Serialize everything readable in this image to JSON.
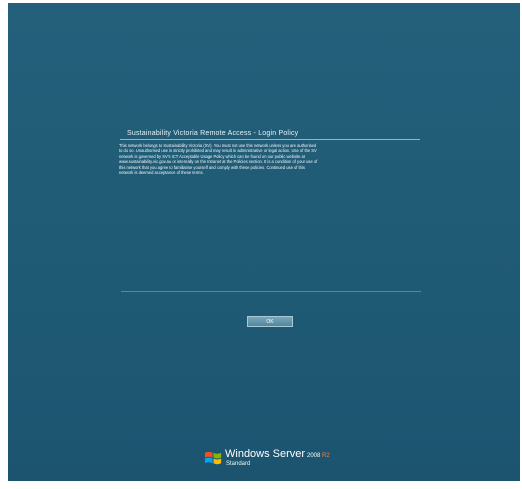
{
  "dialog": {
    "title": "Sustainability Victoria Remote Access - Login Policy",
    "policy_text": "This network belongs to Sustainability Victoria (SV). You must not use this network unless you are authorised\nto do so. Unauthorised use is strictly prohibited and may result in administrative or legal action. Use of the SV\nnetwork is governed by SV's ICT Acceptable Usage Policy which can be found on our public website at\nwww.sustainability.vic.gov.au or internally on the Intranet at the Policies section. It is a condition of your use of\nthis network that you agree to familiarise yourself and comply with these policies. Continued use of this\nnetwork is deemed acceptance of these terms.",
    "ok_label": "OK"
  },
  "branding": {
    "name": "Windows Server",
    "version": "2008",
    "release": "R2",
    "edition": "Standard",
    "icon": "windows-flag-icon",
    "release_color": "#ff7b4a"
  }
}
